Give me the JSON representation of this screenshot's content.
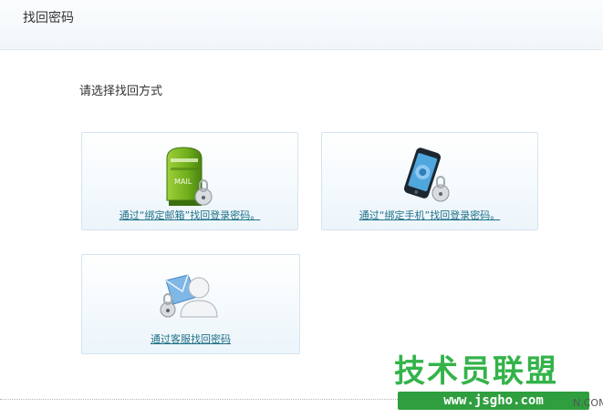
{
  "header": {
    "title": "找回密码"
  },
  "prompt": "请选择找回方式",
  "options": {
    "email": {
      "label": "通过“绑定邮箱”找回登录密码。",
      "icon": "mailbox-lock-icon",
      "mailbox_text": "MAIL"
    },
    "phone": {
      "label": "通过“绑定手机”找回登录密码。",
      "icon": "phone-lock-icon"
    },
    "service": {
      "label": "通过客服找回密码",
      "icon": "customer-service-lock-icon"
    }
  },
  "watermark": {
    "title": "技术员联盟",
    "url": "www.jsgho.com",
    "tail": "N.COM"
  },
  "colors": {
    "link": "#1e6f86",
    "card_border": "#d6e4ee",
    "watermark_green": "#34b34a"
  }
}
